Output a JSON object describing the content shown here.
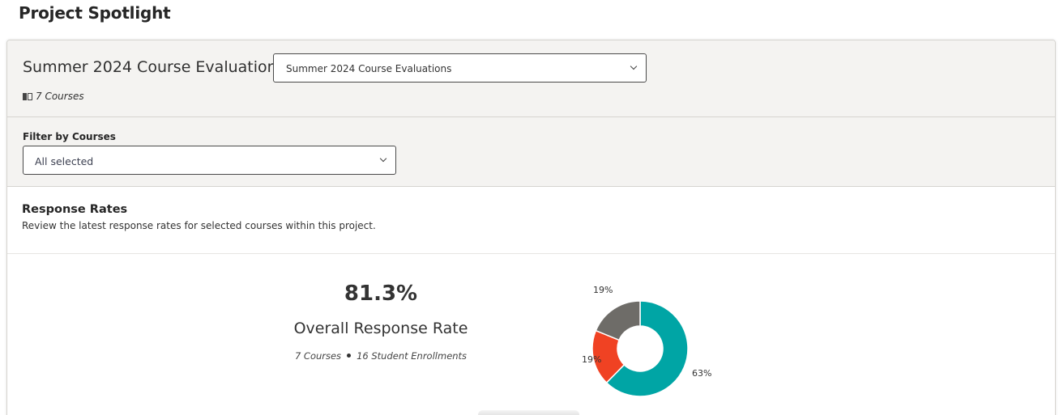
{
  "page": {
    "title": "Project Spotlight"
  },
  "project": {
    "name": "Summer 2024 Course Evaluations",
    "select_value": "Summer 2024 Course Evaluations",
    "courses_count": "7 Courses"
  },
  "filter": {
    "label": "Filter by Courses",
    "value": "All selected"
  },
  "response_rates": {
    "title": "Response Rates",
    "subtitle": "Review the latest response rates for selected courses within this project.",
    "overall_value": "81.3%",
    "overall_label": "Overall Response Rate",
    "courses": "7 Courses",
    "enrollments": "16 Student Enrollments"
  },
  "chart_data": {
    "type": "pie",
    "donut": true,
    "slices": [
      {
        "label": "63%",
        "value": 63,
        "color": "#00a5a5"
      },
      {
        "label": "19%",
        "value": 19,
        "color": "#f04223"
      },
      {
        "label": "19%",
        "value": 19,
        "color": "#6e6c68"
      }
    ]
  }
}
